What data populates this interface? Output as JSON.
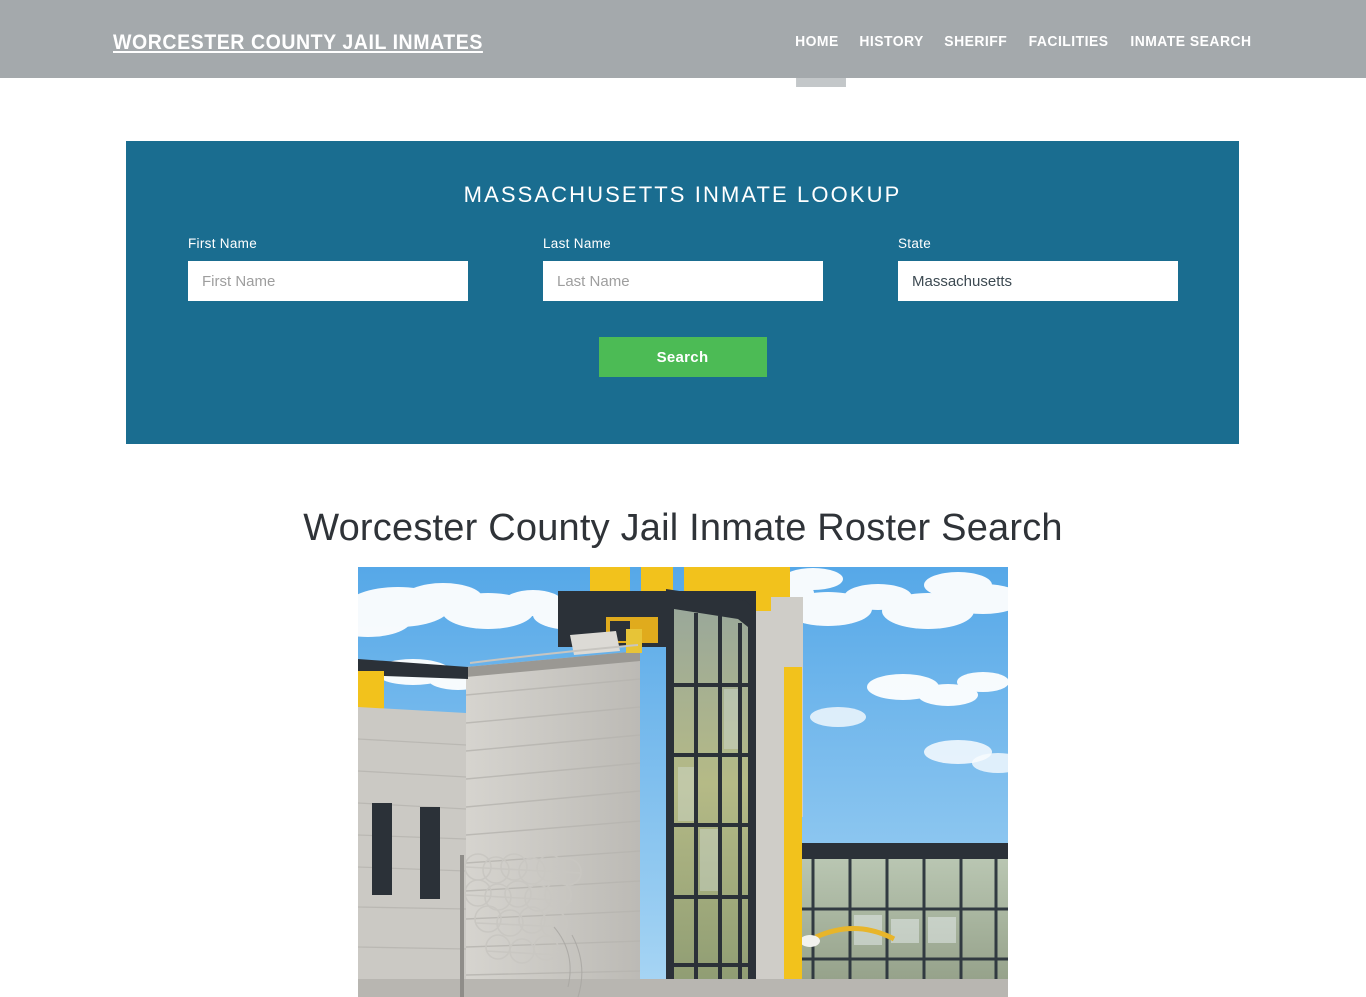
{
  "header": {
    "brand": "WORCESTER COUNTY JAIL INMATES",
    "nav": [
      {
        "label": "HOME",
        "active": true
      },
      {
        "label": "HISTORY",
        "active": false
      },
      {
        "label": "SHERIFF",
        "active": false
      },
      {
        "label": "FACILITIES",
        "active": false
      },
      {
        "label": "INMATE SEARCH",
        "active": false
      }
    ],
    "background_color": "#a4a9ac",
    "active_indicator_color": "#c3c7c9"
  },
  "lookup_panel": {
    "title": "MASSACHUSETTS INMATE LOOKUP",
    "background_color": "#1a6d90",
    "fields": {
      "first_name": {
        "label": "First Name",
        "placeholder": "First Name",
        "value": ""
      },
      "last_name": {
        "label": "Last Name",
        "placeholder": "Last Name",
        "value": ""
      },
      "state": {
        "label": "State",
        "selected": "Massachusetts"
      }
    },
    "search_button": {
      "label": "Search",
      "color": "#4cbb55"
    }
  },
  "main": {
    "page_heading": "Worcester County Jail Inmate Roster Search",
    "photo_alt": "worcester-county-jail-building-photo"
  }
}
